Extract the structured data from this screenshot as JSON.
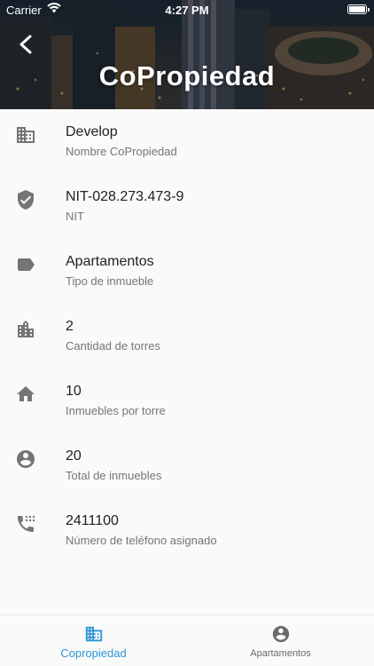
{
  "status_bar": {
    "carrier": "Carrier",
    "time": "4:27 PM"
  },
  "header": {
    "title": "CoPropiedad"
  },
  "colors": {
    "accent": "#2b96d6",
    "icon_grey": "#757575"
  },
  "details": [
    {
      "value": "Develop",
      "label": "Nombre CoPropiedad",
      "icon": "business-icon"
    },
    {
      "value": "NIT-028.273.473-9",
      "label": "NIT",
      "icon": "verified-shield-icon"
    },
    {
      "value": "Apartamentos",
      "label": "Tipo de inmueble",
      "icon": "label-tag-icon"
    },
    {
      "value": "2",
      "label": "Cantidad de torres",
      "icon": "location-city-icon"
    },
    {
      "value": "10",
      "label": "Inmuebles por torre",
      "icon": "home-icon"
    },
    {
      "value": "20",
      "label": "Total de inmuebles",
      "icon": "account-circle-icon"
    },
    {
      "value": "2411100",
      "label": "Número de teléfono asignado",
      "icon": "phone-dial-icon"
    }
  ],
  "bottom_nav": {
    "tabs": [
      {
        "label": "Copropiedad",
        "icon": "business-icon",
        "active": true
      },
      {
        "label": "Apartamentos",
        "icon": "account-circle-icon",
        "active": false
      }
    ]
  }
}
